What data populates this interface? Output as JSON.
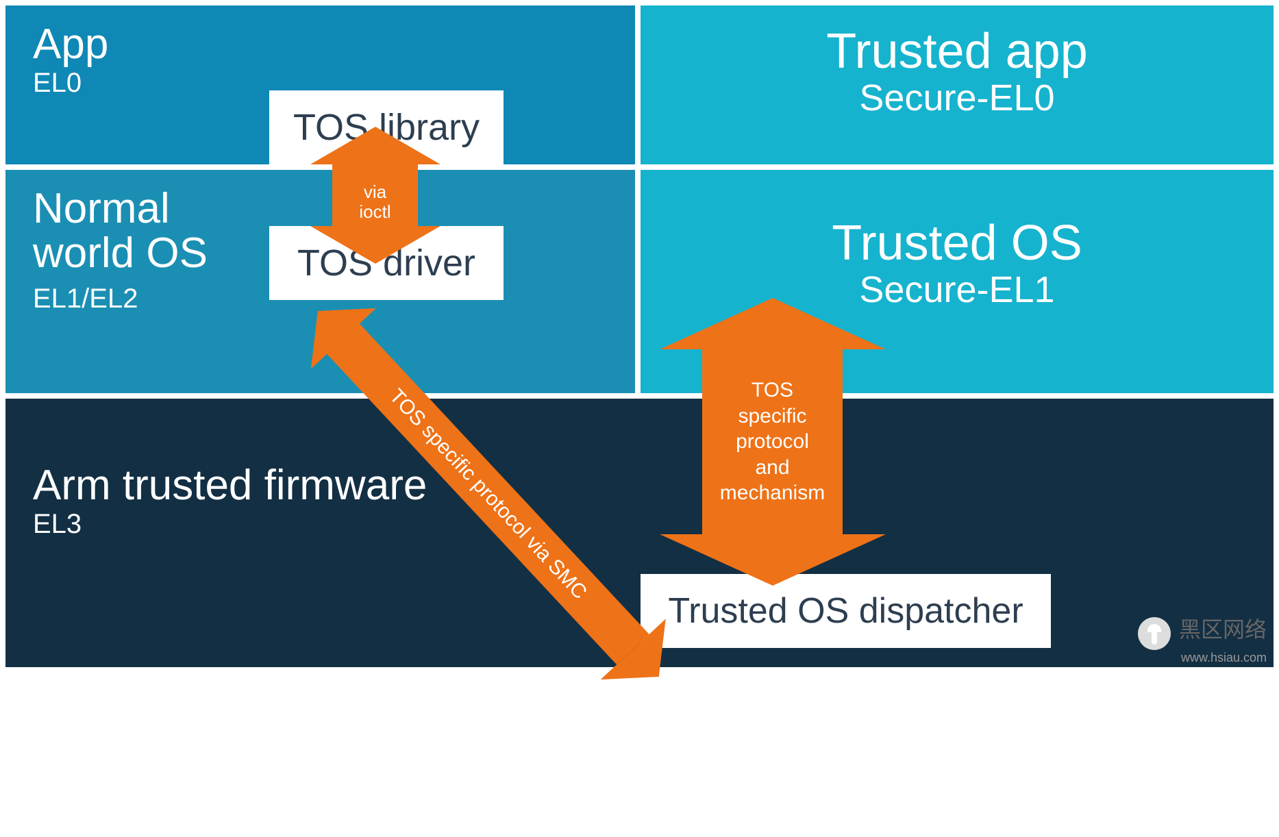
{
  "normal_world": {
    "app": {
      "title": "App",
      "el": "EL0"
    },
    "tos_library": "TOS library",
    "os": {
      "title1": "Normal",
      "title2": "world OS",
      "el": "EL1/EL2"
    },
    "tos_driver": "TOS driver"
  },
  "secure_world": {
    "trusted_app": {
      "title": "Trusted app",
      "el": "Secure-EL0"
    },
    "trusted_os": {
      "title": "Trusted OS",
      "el": "Secure-EL1"
    }
  },
  "firmware": {
    "title": "Arm trusted firmware",
    "el": "EL3"
  },
  "dispatcher": "Trusted OS dispatcher",
  "arrows": {
    "ioctl": "via\nioctl",
    "smc": "TOS specific protocol via SMC",
    "tos_mech": "TOS\nspecific\nprotocol\nand\nmechanism"
  },
  "watermark": {
    "brand": "黑区网络",
    "url": "www.hsiau.com"
  },
  "colors": {
    "normal_blue": "#1b8fb3",
    "secure_cyan": "#16b3ce",
    "firmware_navy": "#132f44",
    "accent_orange": "#ee7217"
  }
}
